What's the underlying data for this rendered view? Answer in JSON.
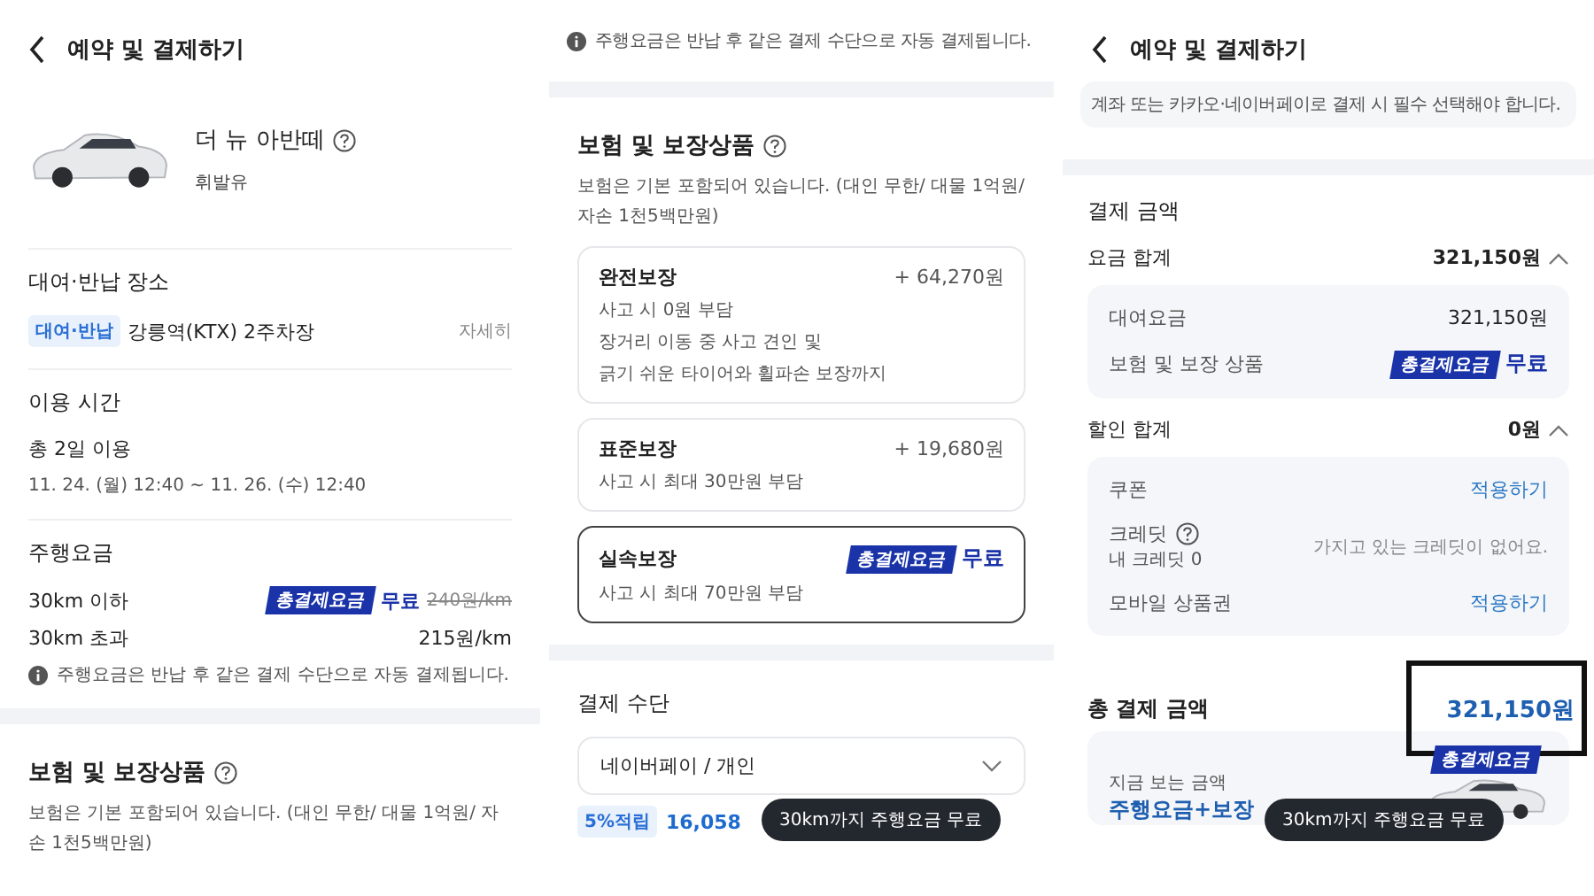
{
  "left_screen": {
    "header": {
      "title": "예약 및 결제하기"
    },
    "car": {
      "name": "더 뉴 아반떼",
      "fuel": "휘발유"
    },
    "location": {
      "heading": "대여·반납 장소",
      "badge": "대여·반납",
      "place": "강릉역(KTX) 2주차장",
      "link": "자세히"
    },
    "usage": {
      "heading": "이용 시간",
      "duration": "총 2일 이용",
      "period": "11. 24. (월) 12:40 ~ 11. 26. (수) 12:40"
    },
    "mileage": {
      "heading": "주행요금",
      "rows": [
        {
          "label": "30km 이하",
          "badge": "총결제요금",
          "price": "무료",
          "original": "240원/km"
        },
        {
          "label": "30km 초과",
          "price": "215원/km"
        }
      ],
      "note": "주행요금은 반납 후 같은 결제 수단으로 자동 결제됩니다."
    },
    "insurance": {
      "heading": "보험 및 보장상품",
      "description": "보험은 기본 포함되어 있습니다. (대인 무한/ 대물 1억원/ 자손 1천5백만원)"
    }
  },
  "middle_screen": {
    "note": "주행요금은 반납 후 같은 결제 수단으로 자동 결제됩니다.",
    "insurance": {
      "heading": "보험 및 보장상품",
      "description": "보험은 기본 포함되어 있습니다. (대인 무한/ 대물 1억원/ 자손 1천5백만원)",
      "options": [
        {
          "name": "완전보장",
          "price": "+ 64,270원",
          "details": [
            "사고 시 0원 부담",
            "장거리 이동 중 사고 견인 및",
            "긁기 쉬운 타이어와 휠파손 보장까지"
          ],
          "selected": false
        },
        {
          "name": "표준보장",
          "price": "+ 19,680원",
          "details": [
            "사고 시 최대 30만원 부담"
          ],
          "selected": false
        },
        {
          "name": "실속보장",
          "badge": "총결제요금",
          "price": "무료",
          "details": [
            "사고 시 최대 70만원 부담"
          ],
          "selected": true
        }
      ]
    },
    "payment": {
      "heading": "결제 수단",
      "method": "네이버페이 / 개인",
      "point_badge": "5%적립",
      "point_amount": "16,058"
    },
    "tooltip": "30km까지 주행요금 무료"
  },
  "right_screen": {
    "header": {
      "title": "예약 및 결제하기"
    },
    "notice": "계좌 또는 카카오·네이버페이로 결제 시 필수 선택해야 합니다.",
    "summary": {
      "heading": "결제 금액",
      "groups": [
        {
          "label": "요금 합계",
          "value": "321,150원",
          "expanded": true,
          "items": [
            {
              "kind": "amount",
              "label": "대여요금",
              "value": "321,150원"
            },
            {
              "kind": "free",
              "label": "보험 및 보장 상품",
              "badge": "총결제요금",
              "value": "무료"
            }
          ]
        },
        {
          "label": "할인 합계",
          "value": "0원",
          "expanded": true,
          "items": [
            {
              "kind": "action",
              "label": "쿠폰",
              "value": "적용하기"
            },
            {
              "kind": "note",
              "label": "크레딧",
              "sub": "내 크레딧 0",
              "value": "가지고 있는 크레딧이 없어요."
            },
            {
              "kind": "action",
              "label": "모바일 상품권",
              "value": "적용하기"
            }
          ]
        }
      ]
    },
    "total": {
      "label": "총 결제 금액",
      "value": "321,150원"
    },
    "promo": {
      "caption": "지금 보는 금액",
      "headline": "주행요금+보장",
      "badge": "총결제요금"
    },
    "tooltip": "30km까지 주행요금 무료"
  }
}
